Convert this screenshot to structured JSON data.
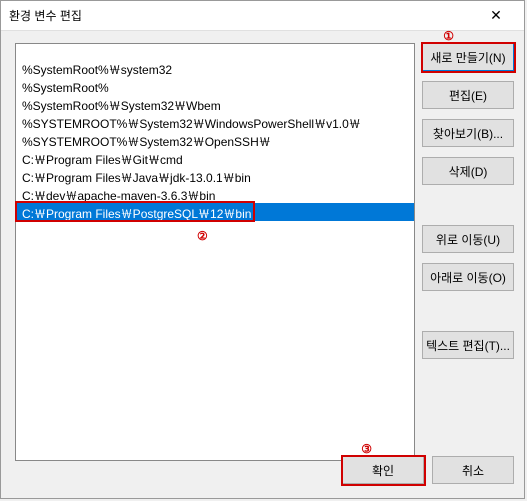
{
  "window": {
    "title": "환경 변수 편집"
  },
  "list": {
    "items": [
      {
        "text": "%SystemRoot%￦system32",
        "selected": false
      },
      {
        "text": "%SystemRoot%",
        "selected": false
      },
      {
        "text": "%SystemRoot%￦System32￦Wbem",
        "selected": false
      },
      {
        "text": "%SYSTEMROOT%￦System32￦WindowsPowerShell￦v1.0￦",
        "selected": false
      },
      {
        "text": "%SYSTEMROOT%￦System32￦OpenSSH￦",
        "selected": false
      },
      {
        "text": "C:￦Program Files￦Git￦cmd",
        "selected": false
      },
      {
        "text": "C:￦Program Files￦Java￦jdk-13.0.1￦bin",
        "selected": false
      },
      {
        "text": "C:￦dev￦apache-maven-3.6.3￦bin",
        "selected": false
      },
      {
        "text": "C:￦Program Files￦PostgreSQL￦12￦bin",
        "selected": true
      }
    ]
  },
  "buttons": {
    "new": "새로 만들기(N)",
    "edit": "편집(E)",
    "browse": "찾아보기(B)...",
    "delete": "삭제(D)",
    "moveup": "위로 이동(U)",
    "movedown": "아래로 이동(O)",
    "edittext": "텍스트 편집(T)...",
    "ok": "확인",
    "cancel": "취소"
  },
  "annotations": {
    "a1": "①",
    "a2": "②",
    "a3": "③"
  }
}
